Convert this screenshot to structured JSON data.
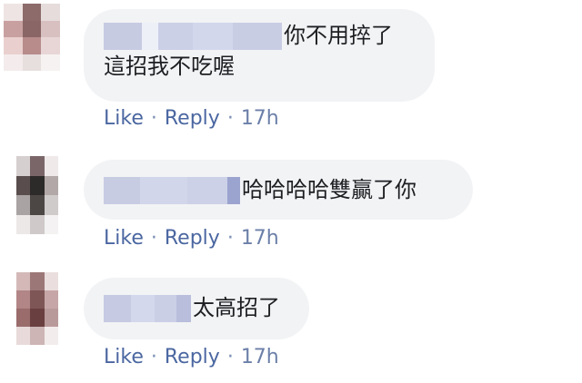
{
  "comments": [
    {
      "text_line1": "你不用捽了",
      "text_line2": "這招我不吃喔",
      "like": "Like",
      "reply": "Reply",
      "sep": "·",
      "time": "17h"
    },
    {
      "text_line1": "哈哈哈哈雙贏了你",
      "like": "Like",
      "reply": "Reply",
      "sep": "·",
      "time": "17h"
    },
    {
      "text_line1": "太高招了",
      "like": "Like",
      "reply": "Reply",
      "sep": "·",
      "time": "17h"
    }
  ],
  "colors": {
    "bubble": "#f2f3f5",
    "link": "#4b67a1",
    "text": "#1c1e21"
  }
}
